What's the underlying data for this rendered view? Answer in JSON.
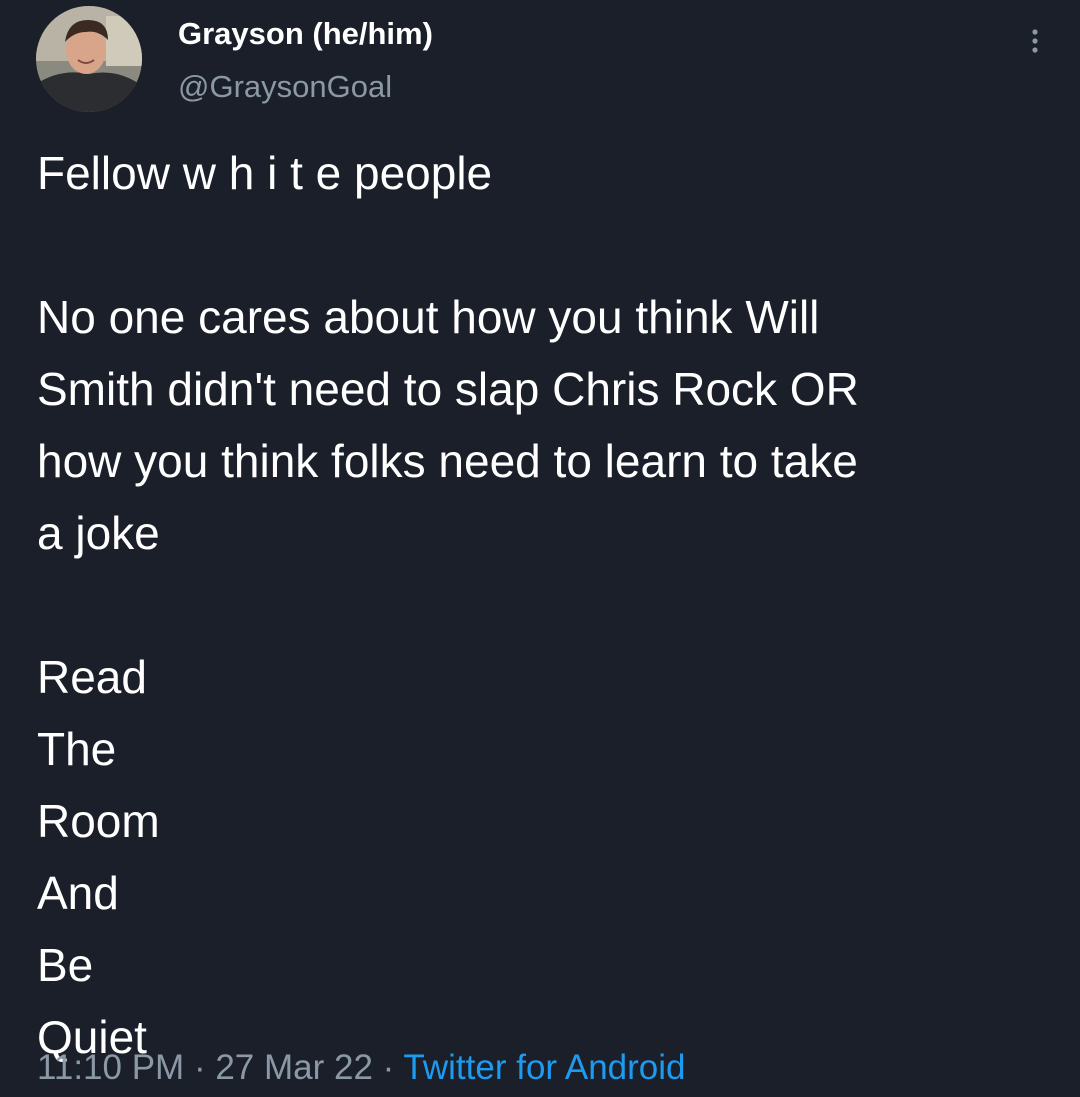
{
  "author": {
    "display_name": "Grayson (he/him)",
    "handle": "@GraysonGoal",
    "avatar_icon": "profile-photo"
  },
  "tweet": {
    "lines": [
      "Fellow w h i t e people",
      "",
      "No one cares about how you think Will",
      "Smith didn't need to slap Chris Rock OR",
      "how you think folks need to learn to take",
      "a joke",
      "",
      "Read",
      "The",
      "Room",
      "And",
      "Be",
      "Quiet"
    ]
  },
  "meta": {
    "time": "11:10 PM",
    "separator": "·",
    "date": "27 Mar 22",
    "source": "Twitter for Android"
  },
  "colors": {
    "background": "#1a1f29",
    "text": "#ffffff",
    "secondary": "#8b98a5",
    "link": "#1d9bf0"
  },
  "menu": {
    "icon": "more-vertical-icon"
  }
}
